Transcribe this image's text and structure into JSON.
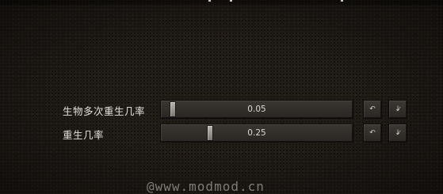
{
  "options": [
    {
      "label": "生物多次重生几率",
      "value_text": "0.05",
      "value": 0.05,
      "undo_icon": "undo-arrow-icon",
      "default_icon": "reset-default-icon"
    },
    {
      "label": "重生几率",
      "value_text": "0.25",
      "value": 0.25,
      "undo_icon": "undo-arrow-icon",
      "default_icon": "reset-default-icon"
    }
  ],
  "icons": {
    "undo_glyph": "↶",
    "default_glyph": "↓̷"
  },
  "watermark": "@www.modmod.cn"
}
